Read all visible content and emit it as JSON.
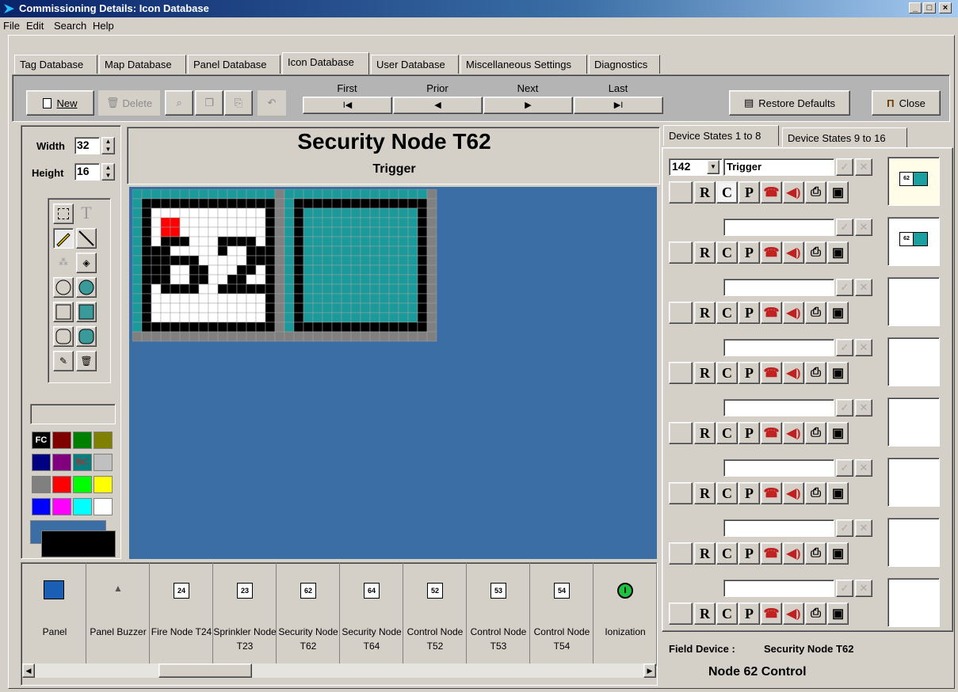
{
  "window": {
    "title": "Commissioning Details: Icon Database",
    "min": "_",
    "max": "□",
    "close": "×"
  },
  "menu": [
    "File",
    "Edit",
    "Search",
    "Help"
  ],
  "tabs": [
    "Tag Database",
    "Map Database",
    "Panel Database",
    "Icon Database",
    "User Database",
    "Miscellaneous Settings",
    "Diagnostics"
  ],
  "toolbar": {
    "new_label": "New",
    "delete_label": "Delete",
    "nav": {
      "first": "First",
      "prior": "Prior",
      "next": "Next",
      "last": "Last"
    },
    "nav_glyphs": {
      "first": "I◀",
      "prior": "◀",
      "next": "▶",
      "last": "▶I"
    },
    "restore_label": "Restore Defaults",
    "close_label": "Close"
  },
  "left": {
    "width_label": "Width",
    "width_value": "32",
    "height_label": "Height",
    "height_value": "16",
    "fc_label": "FC",
    "bc_label": "BC"
  },
  "palette": [
    "#000000",
    "#800000",
    "#008000",
    "#808000",
    "#000080",
    "#800080",
    "#008080",
    "#c0c0c0",
    "#808080",
    "#ff0000",
    "#00ff00",
    "#ffff00",
    "#0000ff",
    "#ff00ff",
    "#00ffff",
    "#ffffff"
  ],
  "icon": {
    "title": "Security Node T62",
    "subtitle": "Trigger"
  },
  "icon_list": [
    {
      "label": "Panel",
      "icon": "panel-icon"
    },
    {
      "label": "Panel Buzzer",
      "icon": "buzzer-icon"
    },
    {
      "label": "Fire Node T24",
      "icon": "node-icon",
      "num": "24"
    },
    {
      "label": "Sprinkler Node T23",
      "icon": "node-icon",
      "num": "23"
    },
    {
      "label": "Security Node T62",
      "icon": "node-icon",
      "num": "62"
    },
    {
      "label": "Security Node T64",
      "icon": "node-icon",
      "num": "64"
    },
    {
      "label": "Control Node T52",
      "icon": "node-icon",
      "num": "52"
    },
    {
      "label": "Control Node T53",
      "icon": "node-icon",
      "num": "53"
    },
    {
      "label": "Control Node T54",
      "icon": "node-icon",
      "num": "54"
    },
    {
      "label": "Ionization",
      "icon": "ionization-icon",
      "num": "I"
    }
  ],
  "device_tabs": [
    "Device States 1 to 8",
    "Device States 9 to 16"
  ],
  "states": [
    {
      "code": "142",
      "text": "Trigger",
      "preview": true
    },
    {
      "code": "",
      "text": "",
      "preview": true
    },
    {
      "code": "",
      "text": "",
      "preview": false
    },
    {
      "code": "",
      "text": "",
      "preview": false
    },
    {
      "code": "",
      "text": "",
      "preview": false
    },
    {
      "code": "",
      "text": "",
      "preview": false
    },
    {
      "code": "",
      "text": "",
      "preview": false
    },
    {
      "code": "",
      "text": "",
      "preview": false
    }
  ],
  "state_buttons": {
    "r": "R",
    "c": "C",
    "p": "P"
  },
  "field_device": {
    "label": "Field Device :",
    "value": "Security Node T62",
    "control": "Node 62 Control"
  }
}
